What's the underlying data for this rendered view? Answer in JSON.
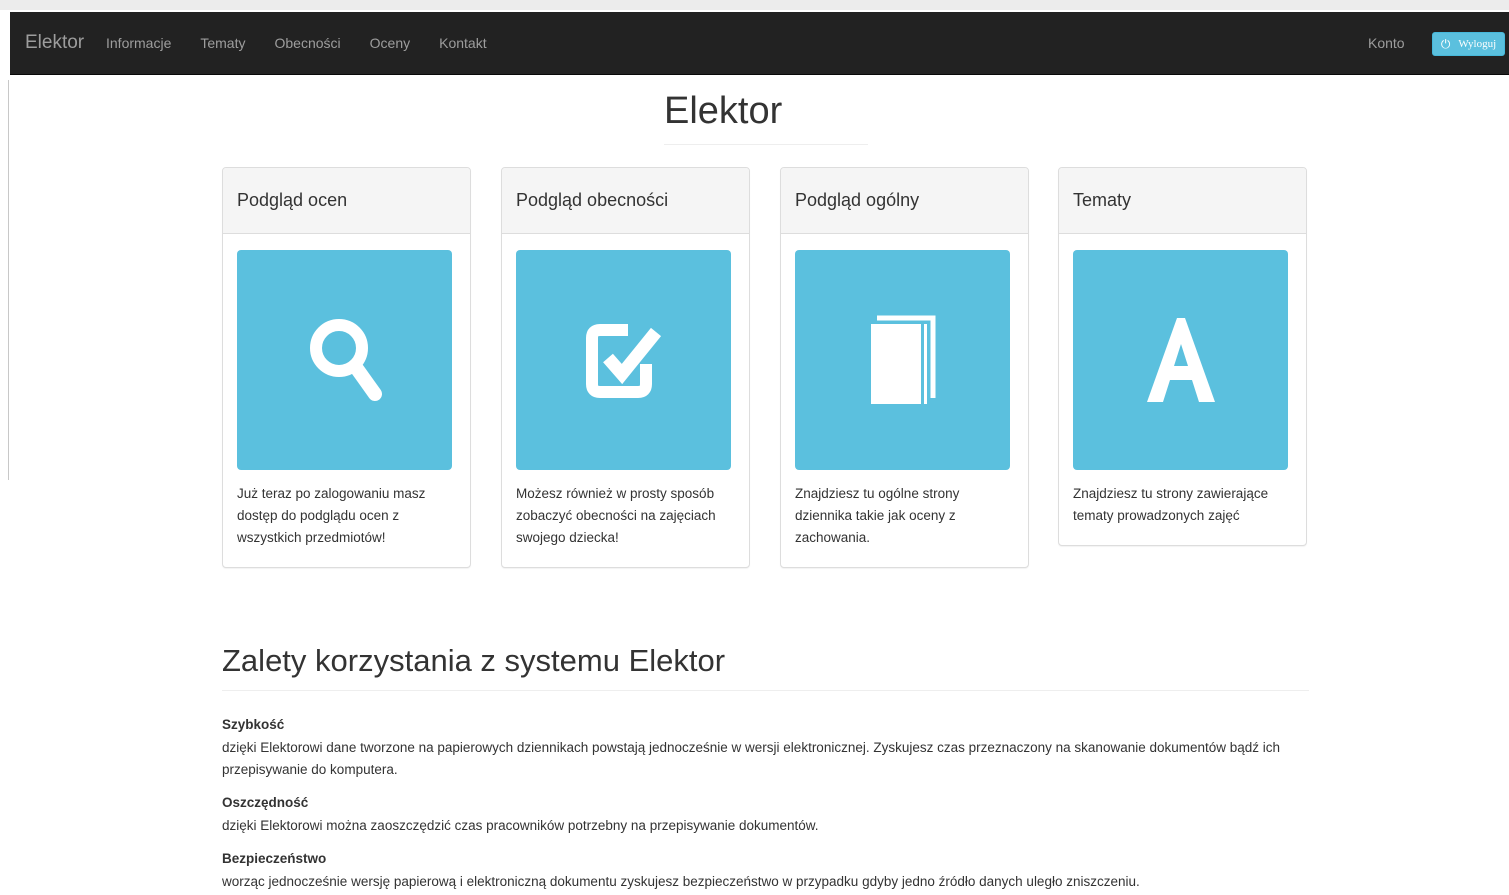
{
  "navbar": {
    "brand": "Elektor",
    "items": [
      "Informacje",
      "Tematy",
      "Obecności",
      "Oceny",
      "Kontakt"
    ],
    "account_label": "Konto",
    "logout_label": "Wyloguj",
    "logout_icon": "power-icon"
  },
  "page": {
    "title": "Elektor"
  },
  "cards": [
    {
      "title": "Podgląd ocen",
      "icon": "search-icon",
      "text": "Już teraz po zalogowaniu masz dostęp do podglądu ocen z wszystkich przedmiotów!"
    },
    {
      "title": "Podgląd obecności",
      "icon": "checkbox-icon",
      "text": "Możesz również w prosty sposób zobaczyć obecności na zajęciach swojego dziecka!"
    },
    {
      "title": "Podgląd ogólny",
      "icon": "book-icon",
      "text": "Znajdziesz tu ogólne strony dziennika takie jak oceny z zachowania."
    },
    {
      "title": "Tematy",
      "icon": "letter-a-icon",
      "text": "Znajdziesz tu strony zawierające tematy prowadzonych zajęć"
    }
  ],
  "advantages": {
    "heading": "Zalety korzystania z systemu Elektor",
    "items": [
      {
        "title": "Szybkość",
        "text": "dzięki Elektorowi dane tworzone na papierowych dziennikach powstają jednocześnie w wersji elektronicznej. Zyskujesz czas przeznaczony na skanowanie dokumentów bądź ich przepisywanie do komputera."
      },
      {
        "title": "Oszczędność",
        "text": "dzięki Elektorowi można zaoszczędzić czas pracowników potrzebny na przepisywanie dokumentów."
      },
      {
        "title": "Bezpieczeństwo",
        "text": "worząc jednocześnie wersję papierową i elektroniczną dokumentu zyskujesz bezpieczeństwo w przypadku gdyby jedno źródło danych uległo zniszczeniu."
      }
    ]
  },
  "colors": {
    "navbar_bg": "#222222",
    "accent_info": "#5bc0de",
    "card_header_bg": "#f5f5f5"
  }
}
